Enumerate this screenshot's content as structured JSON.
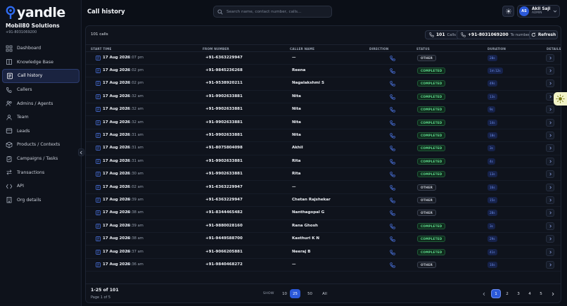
{
  "brand": {
    "logo_text": "yandle",
    "org_name": "Mobil80 Solutions",
    "org_phone": "+91-8031069200"
  },
  "nav": [
    {
      "label": "Dashboard",
      "icon": "grid-icon"
    },
    {
      "label": "Knowledge Base",
      "icon": "book-icon"
    },
    {
      "label": "Call history",
      "icon": "phone-log-icon",
      "active": true
    },
    {
      "label": "Callers",
      "icon": "caller-icon"
    },
    {
      "label": "Admins / Agents",
      "icon": "users-icon"
    },
    {
      "label": "Team",
      "icon": "team-icon"
    },
    {
      "label": "Leads",
      "icon": "leads-icon"
    },
    {
      "label": "Products / Contexts",
      "icon": "box-icon"
    },
    {
      "label": "Campaigns / Tasks",
      "icon": "clipboard-icon"
    },
    {
      "label": "Transactions",
      "icon": "transactions-icon"
    },
    {
      "label": "API",
      "icon": "api-icon"
    },
    {
      "label": "Org details",
      "icon": "building-icon"
    }
  ],
  "header": {
    "title": "Call history",
    "search_placeholder": "Search name, contact number, calls...",
    "user": {
      "initials": "AS",
      "name": "Akil Saji",
      "role": "ADMIN"
    }
  },
  "toolbar": {
    "calls_count": "101 calls",
    "calls_chip_value": "101",
    "calls_chip_label": "Calls",
    "number_chip_value": "+91-8031069200",
    "number_chip_label": "To number",
    "refresh_label": "Refresh"
  },
  "table": {
    "columns": [
      "START TIME",
      "FROM NUMBER",
      "CALLER NAME",
      "DIRECTION",
      "STATUS",
      "DURATION",
      "DETAILS"
    ],
    "rows": [
      {
        "date": "17 Aug 2026",
        "time": "12:07 pm",
        "number": "+91-6363229947",
        "name": "—",
        "status": "OTHER",
        "duration": "28s"
      },
      {
        "date": "17 Aug 2026",
        "time": "12:02 pm",
        "number": "+91-9845236268",
        "name": "Reena",
        "status": "COMPLETED",
        "duration": "1m 12s"
      },
      {
        "date": "17 Aug 2026",
        "time": "12:02 pm",
        "number": "+91-9538920211",
        "name": "Nagalakshmi S",
        "status": "COMPLETED",
        "duration": "49s"
      },
      {
        "date": "17 Aug 2026",
        "time": "11:32 am",
        "number": "+91-9902633881",
        "name": "Nita",
        "status": "COMPLETED",
        "duration": "13s"
      },
      {
        "date": "17 Aug 2026",
        "time": "11:32 am",
        "number": "+91-9902633881",
        "name": "Nita",
        "status": "COMPLETED",
        "duration": "9s"
      },
      {
        "date": "17 Aug 2026",
        "time": "11:32 am",
        "number": "+91-9902633881",
        "name": "Nita",
        "status": "COMPLETED",
        "duration": "14s"
      },
      {
        "date": "17 Aug 2026",
        "time": "11:31 am",
        "number": "+91-9902633881",
        "name": "Nita",
        "status": "COMPLETED",
        "duration": "18s"
      },
      {
        "date": "17 Aug 2026",
        "time": "11:31 am",
        "number": "+91-8075804098",
        "name": "Akhil",
        "status": "COMPLETED",
        "duration": "3s"
      },
      {
        "date": "17 Aug 2026",
        "time": "11:31 am",
        "number": "+91-9902633881",
        "name": "Rita",
        "status": "COMPLETED",
        "duration": "4s"
      },
      {
        "date": "17 Aug 2026",
        "time": "11:30 am",
        "number": "+91-9902633881",
        "name": "Rita",
        "status": "COMPLETED",
        "duration": "13s"
      },
      {
        "date": "17 Aug 2026",
        "time": "11:02 am",
        "number": "+91-6363229947",
        "name": "—",
        "status": "OTHER",
        "duration": "16s"
      },
      {
        "date": "17 Aug 2026",
        "time": "10:39 am",
        "number": "+91-6363229947",
        "name": "Chetan Rajshekar",
        "status": "OTHER",
        "duration": "15s"
      },
      {
        "date": "17 Aug 2026",
        "time": "10:38 am",
        "number": "+91-8344465482",
        "name": "Nanthagopal G",
        "status": "OTHER",
        "duration": "28s"
      },
      {
        "date": "17 Aug 2026",
        "time": "10:39 am",
        "number": "+91-9880028160",
        "name": "Rana Ghosh",
        "status": "COMPLETED",
        "duration": "3s"
      },
      {
        "date": "17 Aug 2026",
        "time": "10:38 am",
        "number": "+91-9449588700",
        "name": "Kasthuri K N",
        "status": "COMPLETED",
        "duration": "29s"
      },
      {
        "date": "17 Aug 2026",
        "time": "10:37 am",
        "number": "+91-9066205881",
        "name": "Neeraj B",
        "status": "COMPLETED",
        "duration": "41s"
      },
      {
        "date": "17 Aug 2026",
        "time": "10:36 am",
        "number": "+91-9840468272",
        "name": "—",
        "status": "OTHER",
        "duration": "10s"
      }
    ]
  },
  "footer": {
    "range": "1-25 of 101",
    "page_of": "Page 1 of 5",
    "show_label": "SHOW",
    "page_sizes": [
      "10",
      "25",
      "50",
      "All"
    ],
    "active_size": "25",
    "pages": [
      "1",
      "2",
      "3",
      "4",
      "5"
    ],
    "active_page": "1"
  },
  "colors": {
    "accent": "#2b59d9",
    "completed": "#5fdc8e",
    "background": "#0b0f17"
  }
}
